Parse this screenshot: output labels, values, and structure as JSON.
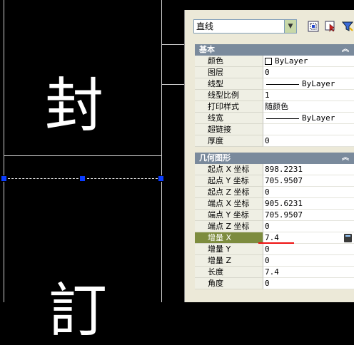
{
  "canvas": {
    "char_top": "封",
    "char_bottom": "訂"
  },
  "palette": {
    "object_type": "直线",
    "sections": [
      {
        "title": "基本",
        "collapse_icon": "chevron-up-double",
        "rows": [
          {
            "label": "颜色",
            "value": "ByLayer",
            "kind": "color"
          },
          {
            "label": "图层",
            "value": "0"
          },
          {
            "label": "线型",
            "value": "ByLayer",
            "kind": "linetype"
          },
          {
            "label": "线型比例",
            "value": "1"
          },
          {
            "label": "打印样式",
            "value": "随颜色",
            "cjk": true
          },
          {
            "label": "线宽",
            "value": "ByLayer",
            "kind": "linetype"
          },
          {
            "label": "超链接",
            "value": ""
          },
          {
            "label": "厚度",
            "value": "0"
          }
        ]
      },
      {
        "title": "几何图形",
        "collapse_icon": "chevron-up-double",
        "rows": [
          {
            "label": "起点 X 坐标",
            "value": "898.2231"
          },
          {
            "label": "起点 Y 坐标",
            "value": "705.9507"
          },
          {
            "label": "起点 Z 坐标",
            "value": "0"
          },
          {
            "label": "端点 X 坐标",
            "value": "905.6231"
          },
          {
            "label": "端点 Y 坐标",
            "value": "705.9507"
          },
          {
            "label": "端点 Z 坐标",
            "value": "0"
          },
          {
            "label": "增量 X",
            "value": "7.4",
            "selected": true
          },
          {
            "label": "增量 Y",
            "value": "0"
          },
          {
            "label": "增量 Z",
            "value": "0"
          },
          {
            "label": "长度",
            "value": "7.4"
          },
          {
            "label": "角度",
            "value": "0"
          }
        ]
      }
    ]
  },
  "colors": {
    "selection_label_bg": "#7d8c3e",
    "grip": "#0a3cff",
    "annotation_underline": "#e11111"
  }
}
